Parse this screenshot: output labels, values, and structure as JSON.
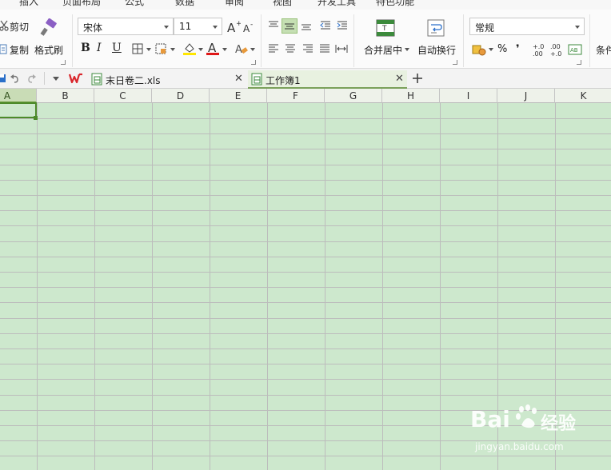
{
  "menu": {
    "tabs": [
      "插入",
      "页面布局",
      "公式",
      "数据",
      "审阅",
      "视图",
      "开发工具",
      "特色功能"
    ]
  },
  "ribbon": {
    "clipboard": {
      "cut": "剪切",
      "copy": "复制",
      "format_painter": "格式刷"
    },
    "font": {
      "name": "宋体",
      "size": "11",
      "bold": "B",
      "italic": "I",
      "underline": "U",
      "font_color_glyph": "A"
    },
    "alignment": {
      "merge_center": "合并居中",
      "wrap_text": "自动换行",
      "merge_glyph": "T"
    },
    "number": {
      "format": "常规",
      "percent": "%",
      "comma": "❜",
      "inc_decimal": "+.0\n.00",
      "dec_decimal": ".00\n+.0"
    },
    "cut_off_right": "条件"
  },
  "quick_access": {
    "icons": [
      "save-icon",
      "undo-icon",
      "redo-icon",
      "customize-dropdown-icon"
    ]
  },
  "tabs": [
    {
      "title": "末日卷二.xls",
      "active": false
    },
    {
      "title": "工作簿1",
      "active": true
    }
  ],
  "sheet": {
    "columns": [
      "A",
      "B",
      "C",
      "D",
      "E",
      "F",
      "G",
      "H",
      "I",
      "J",
      "K"
    ],
    "active_column": "A",
    "background": "#cde8cd",
    "accent": "#4c8a2a"
  },
  "watermark": {
    "brand": "Bai",
    "brand_suffix": "经验",
    "url": "jingyan.baidu.com"
  }
}
